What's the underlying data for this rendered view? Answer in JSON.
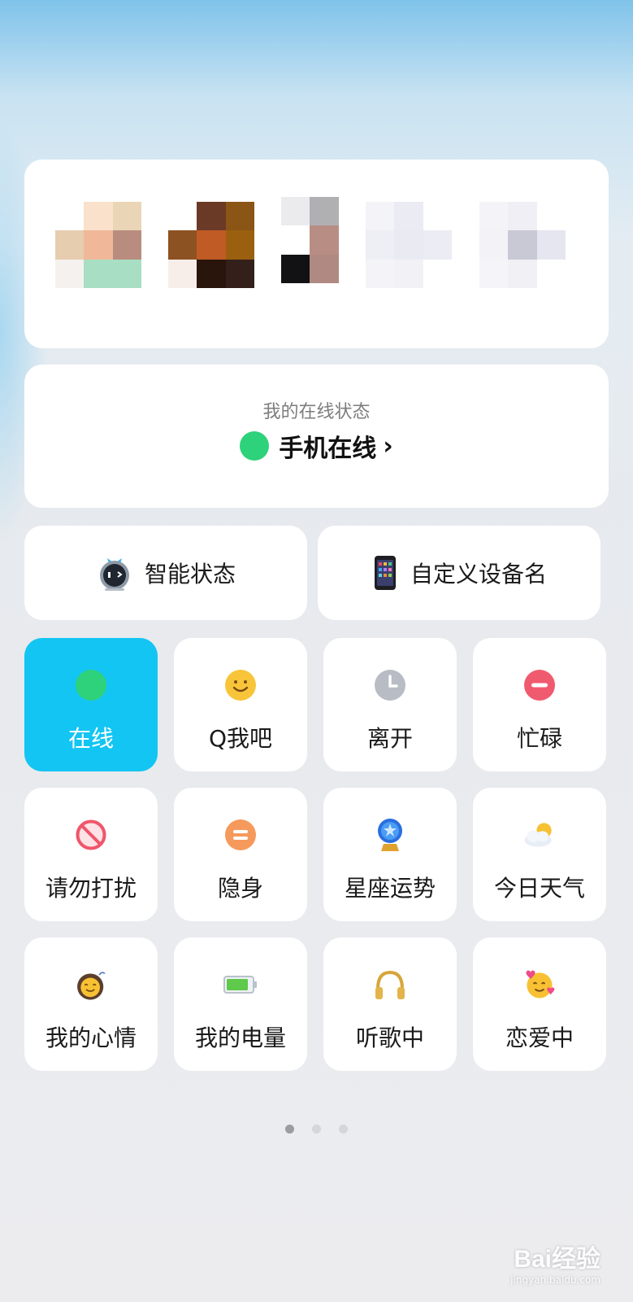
{
  "colors": {
    "accent": "#13c5f2",
    "online_green": "#2ed27a",
    "card_bg": "#ffffff"
  },
  "avatars": [
    {
      "name": "friend-avatar-1"
    },
    {
      "name": "friend-avatar-2"
    },
    {
      "name": "friend-avatar-3"
    },
    {
      "name": "friend-avatar-4"
    },
    {
      "name": "friend-avatar-5"
    }
  ],
  "status": {
    "caption": "我的在线状态",
    "current": "手机在线",
    "chevron": "›"
  },
  "quick": {
    "smart_status": {
      "label": "智能状态",
      "icon": "robot-icon"
    },
    "device_name": {
      "label": "自定义设备名",
      "icon": "phone-icon"
    }
  },
  "tiles": [
    {
      "label": "在线",
      "icon": "green-dot-icon",
      "selected": true
    },
    {
      "label": "Q我吧",
      "icon": "smile-face-icon"
    },
    {
      "label": "离开",
      "icon": "clock-icon"
    },
    {
      "label": "忙碌",
      "icon": "busy-minus-icon"
    },
    {
      "label": "请勿打扰",
      "icon": "no-entry-icon"
    },
    {
      "label": "隐身",
      "icon": "invisible-icon"
    },
    {
      "label": "星座运势",
      "icon": "crystal-ball-icon"
    },
    {
      "label": "今日天气",
      "icon": "weather-icon"
    },
    {
      "label": "我的心情",
      "icon": "mood-icon"
    },
    {
      "label": "我的电量",
      "icon": "battery-icon"
    },
    {
      "label": "听歌中",
      "icon": "headphones-icon"
    },
    {
      "label": "恋爱中",
      "icon": "hearts-face-icon"
    }
  ],
  "pager": {
    "pages": 3,
    "current": 1
  },
  "watermark": {
    "main": "Bai经验",
    "sub": "jingyan.baidu.com"
  }
}
